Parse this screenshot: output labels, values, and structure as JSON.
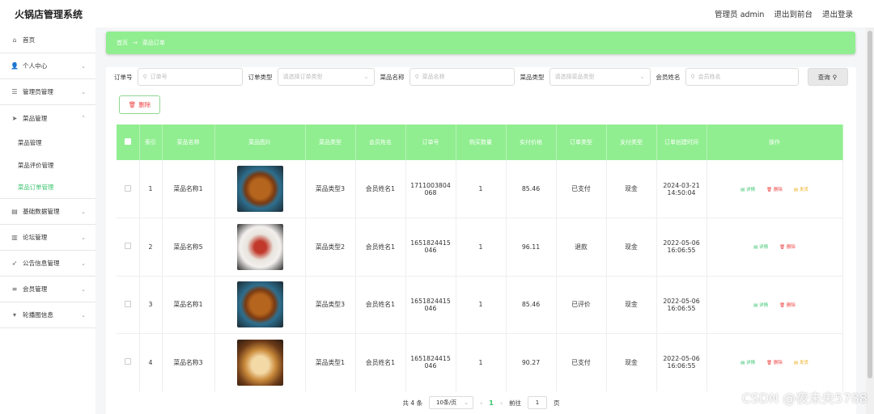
{
  "app": {
    "title": "火锅店管理系统"
  },
  "header": {
    "user_label": "管理员 admin",
    "to_front_label": "退出到前台",
    "logout_label": "退出登录"
  },
  "sidebar": {
    "items": [
      {
        "label": "首页",
        "icon": "home-icon"
      },
      {
        "label": "个人中心",
        "icon": "user-icon"
      },
      {
        "label": "管理员管理",
        "icon": "sliders-icon"
      },
      {
        "label": "菜品管理",
        "icon": "send-icon"
      },
      {
        "label": "基础数据管理",
        "icon": "database-icon"
      },
      {
        "label": "论坛管理",
        "icon": "forum-icon"
      },
      {
        "label": "公告信息管理",
        "icon": "megaphone-icon"
      },
      {
        "label": "会员管理",
        "icon": "list-icon"
      },
      {
        "label": "轮播图信息",
        "icon": "carousel-icon"
      }
    ],
    "sub_items": [
      "菜品管理",
      "菜品评价管理",
      "菜品订单管理"
    ]
  },
  "breadcrumb": {
    "home": "首页",
    "current": "菜品订单"
  },
  "filters": {
    "order_no_label": "订单号",
    "order_no_placeholder": "订单号",
    "order_type_label": "订单类型",
    "order_type_placeholder": "请选择订单类型",
    "dish_name_label": "菜品名称",
    "dish_name_placeholder": "菜品名称",
    "dish_type_label": "菜品类型",
    "dish_type_placeholder": "请选择菜品类型",
    "member_label": "会员姓名",
    "member_placeholder": "会员姓名",
    "query_label": "查询"
  },
  "toolbar": {
    "delete_label": "删除"
  },
  "table": {
    "headers": [
      "索引",
      "菜品名称",
      "菜品图片",
      "菜品类型",
      "会员姓名",
      "订单号",
      "购买数量",
      "实付价格",
      "订单类型",
      "支付类型",
      "订单创建时间",
      "操作"
    ],
    "rows": [
      {
        "index": "1",
        "dish": "菜品名称1",
        "type": "菜品类型3",
        "member": "会员姓名1",
        "order_no_a": "1711003804",
        "order_no_b": "068",
        "qty": "1",
        "price": "85.46",
        "order_type": "已支付",
        "pay": "现金",
        "date": "2024-03-21",
        "time": "14:50:04",
        "ops": [
          "详情",
          "删除",
          "发货"
        ]
      },
      {
        "index": "2",
        "dish": "菜品名称5",
        "type": "菜品类型2",
        "member": "会员姓名1",
        "order_no_a": "1651824415",
        "order_no_b": "046",
        "qty": "1",
        "price": "96.11",
        "order_type": "退款",
        "pay": "现金",
        "date": "2022-05-06",
        "time": "16:06:55",
        "ops": [
          "详情",
          "删除"
        ]
      },
      {
        "index": "3",
        "dish": "菜品名称1",
        "type": "菜品类型3",
        "member": "会员姓名1",
        "order_no_a": "1651824415",
        "order_no_b": "046",
        "qty": "1",
        "price": "85.46",
        "order_type": "已评价",
        "pay": "现金",
        "date": "2022-05-06",
        "time": "16:06:55",
        "ops": [
          "详情",
          "删除"
        ]
      },
      {
        "index": "4",
        "dish": "菜品名称3",
        "type": "菜品类型1",
        "member": "会员姓名1",
        "order_no_a": "1651824415",
        "order_no_b": "046",
        "qty": "1",
        "price": "90.27",
        "order_type": "已支付",
        "pay": "现金",
        "date": "2022-05-06",
        "time": "16:06:55",
        "ops": [
          "详情",
          "删除",
          "发货"
        ]
      }
    ]
  },
  "pager": {
    "total": "共 4 条",
    "page_size": "10条/页",
    "current_page": "1",
    "goto_label": "前往",
    "goto_value": "1",
    "page_suffix": "页"
  },
  "watermark": "CSDN @夜未央5788",
  "colors": {
    "accent_green": "#90ee90",
    "active_text": "#3ac46f",
    "delete_red": "#e44444",
    "ship_orange": "#f0b020"
  }
}
